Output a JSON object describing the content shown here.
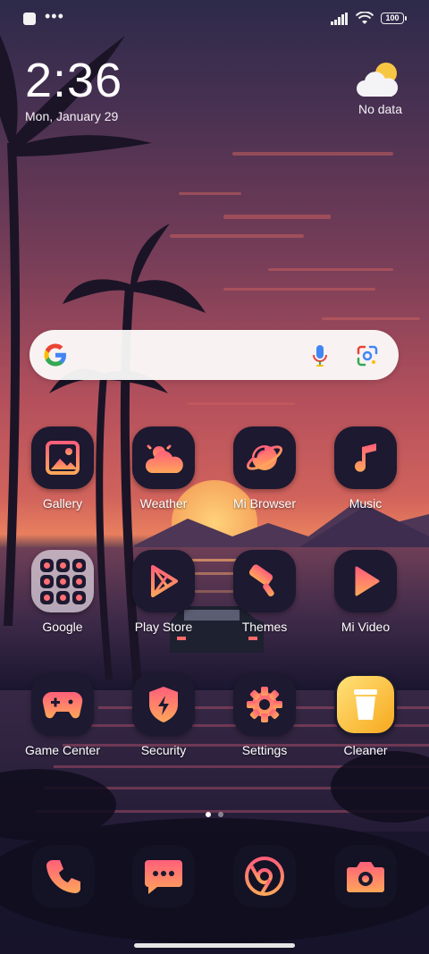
{
  "status_bar": {
    "battery": "100"
  },
  "clock": {
    "time": "2:36",
    "date": "Mon, January 29"
  },
  "weather": {
    "text": "No data"
  },
  "search": {
    "placeholder": ""
  },
  "apps": [
    {
      "label": "Gallery"
    },
    {
      "label": "Weather"
    },
    {
      "label": "Mi Browser"
    },
    {
      "label": "Music"
    },
    {
      "label": "Google"
    },
    {
      "label": "Play Store"
    },
    {
      "label": "Themes"
    },
    {
      "label": "Mi Video"
    },
    {
      "label": "Game Center"
    },
    {
      "label": "Security"
    },
    {
      "label": "Settings"
    },
    {
      "label": "Cleaner"
    }
  ],
  "page_indicator": {
    "pages": 2,
    "current": 1
  },
  "colors": {
    "accent_top": "#ff5f7a",
    "accent_bottom": "#ffb35a",
    "icon_bg": "#1c1930"
  }
}
